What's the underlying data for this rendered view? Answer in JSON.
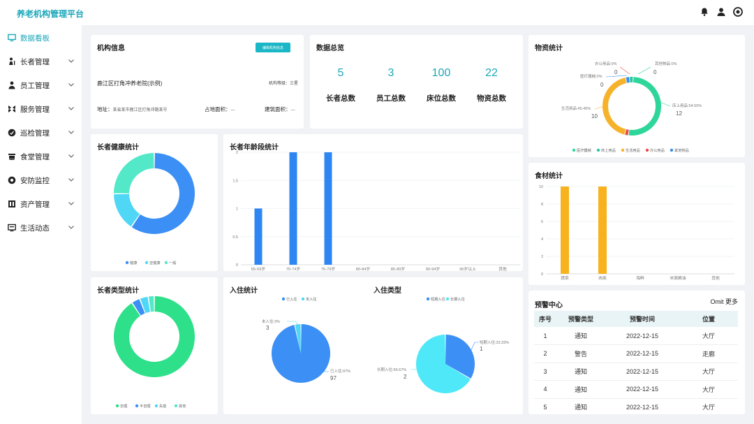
{
  "app": {
    "title": "养老机构管理平台"
  },
  "header_icons": [
    "bell-icon",
    "user-icon",
    "power-icon"
  ],
  "sidebar": {
    "items": [
      {
        "label": "数据看板",
        "icon": "monitor-icon",
        "active": true
      },
      {
        "label": "长者管理",
        "icon": "elder-icon"
      },
      {
        "label": "员工管理",
        "icon": "staff-icon"
      },
      {
        "label": "服务管理",
        "icon": "service-icon"
      },
      {
        "label": "巡检管理",
        "icon": "inspect-icon"
      },
      {
        "label": "食堂管理",
        "icon": "canteen-icon"
      },
      {
        "label": "安防监控",
        "icon": "camera-icon"
      },
      {
        "label": "资产管理",
        "icon": "asset-icon"
      },
      {
        "label": "生活动态",
        "icon": "life-icon"
      }
    ]
  },
  "org_info": {
    "title": "机构信息",
    "edit_label": "编辑机构信息",
    "name": "鹿江区打角冲养老院(示例)",
    "level_label": "机构等级：",
    "level_value": "三星",
    "address_label": "地址：",
    "address_value": "某省某市鹿江区打角冲路某号",
    "area_label": "占地面积：",
    "area_value": "—",
    "build_label": "建筑面积：",
    "build_value": "—"
  },
  "overview": {
    "title": "数据总览",
    "stats": [
      {
        "value": "5",
        "label": "长者总数"
      },
      {
        "value": "3",
        "label": "员工总数"
      },
      {
        "value": "100",
        "label": "床位总数"
      },
      {
        "value": "22",
        "label": "物资总数"
      }
    ]
  },
  "health": {
    "title": "长者健康统计",
    "legend": [
      "健康",
      "亚健康",
      "一般"
    ]
  },
  "age": {
    "title": "长者年龄段统计"
  },
  "elder_type": {
    "title": "长者类型统计",
    "legend": [
      "自理",
      "半自理",
      "失能",
      "其他"
    ]
  },
  "checkin": {
    "title": "入住统计",
    "legend": [
      "已入住",
      "未入住"
    ]
  },
  "checkin_type": {
    "title": "入住类型",
    "legend": [
      "短期入住",
      "长期入住"
    ]
  },
  "supplies": {
    "title": "物资统计",
    "legend": [
      "医疗器械",
      "床上用品",
      "生活用品",
      "办公用品",
      "其他物品"
    ]
  },
  "food": {
    "title": "食材统计"
  },
  "alerts": {
    "title": "预警中心",
    "more": "Omit 更多",
    "columns": [
      "序号",
      "预警类型",
      "预警时间",
      "位置"
    ],
    "rows": [
      {
        "no": "1",
        "type": "通知",
        "time": "2022-12-15",
        "loc": "大厅"
      },
      {
        "no": "2",
        "type": "警告",
        "time": "2022-12-15",
        "loc": "走廊"
      },
      {
        "no": "3",
        "type": "通知",
        "time": "2022-12-15",
        "loc": "大厅"
      },
      {
        "no": "4",
        "type": "通知",
        "time": "2022-12-15",
        "loc": "大厅"
      },
      {
        "no": "5",
        "type": "通知",
        "time": "2022-12-15",
        "loc": "大厅"
      }
    ]
  },
  "chart_data": [
    {
      "type": "pie",
      "title": "长者健康统计",
      "labels": [
        "健康",
        "亚健康",
        "一般"
      ],
      "values": [
        60,
        15,
        25
      ],
      "colors": [
        "#3b8ff5",
        "#4fd7f5",
        "#52e8c8"
      ]
    },
    {
      "type": "bar",
      "title": "长者年龄段统计",
      "categories": [
        "65-69岁",
        "70-74岁",
        "75-79岁",
        "80-84岁",
        "85-89岁",
        "90-94岁",
        "95岁以上",
        "其他"
      ],
      "values": [
        1,
        2,
        2,
        0,
        0,
        0,
        0,
        0
      ],
      "yticks": [
        "0",
        "0.5",
        "1",
        "1.5",
        "2"
      ],
      "ylim": [
        0,
        2
      ],
      "color": "#2e86f3"
    },
    {
      "type": "pie",
      "title": "长者类型统计",
      "labels": [
        "自理",
        "半自理",
        "失能",
        "其他"
      ],
      "values": [
        92,
        3,
        3,
        2
      ],
      "colors": [
        "#2ee08a",
        "#3b8ff5",
        "#4fd7f5",
        "#52e8c8"
      ]
    },
    {
      "type": "pie",
      "title": "入住统计",
      "labels": [
        "已入住",
        "未入住"
      ],
      "values": [
        97,
        3
      ],
      "data_labels": [
        "已入住:97%",
        "未入住:3%"
      ],
      "counts": [
        "97",
        "3"
      ],
      "colors": [
        "#3b8ff5",
        "#4fd7f5"
      ]
    },
    {
      "type": "pie",
      "title": "入住类型",
      "labels": [
        "短期入住",
        "长期入住"
      ],
      "values": [
        1,
        2
      ],
      "data_labels": [
        "短期入住:33.33%",
        "长期入住:66.67%"
      ],
      "counts": [
        "1",
        "2"
      ],
      "colors": [
        "#3b8ff5",
        "#4fe8f8"
      ]
    },
    {
      "type": "pie",
      "title": "物资统计",
      "labels": [
        "医疗器械",
        "床上用品",
        "生活用品",
        "办公用品",
        "其他物品"
      ],
      "values": [
        12,
        0,
        10,
        0,
        0
      ],
      "data_labels": [
        "床上用品:54.55%",
        "生活用品:45.45%",
        "医疗器械:0%",
        "办公用品:0%",
        "其他物品:0%"
      ],
      "counts": [
        "12",
        "10",
        "0",
        "0",
        "0"
      ],
      "colors": [
        "#2ed69a",
        "#27c9a0",
        "#f7b22b",
        "#ee4a4a",
        "#2f8ff0"
      ]
    },
    {
      "type": "bar",
      "title": "食材统计",
      "categories": [
        "蔬菜",
        "肉类",
        "海鲜",
        "米面粮油",
        "其他"
      ],
      "values": [
        10,
        10,
        0,
        0,
        0
      ],
      "yticks": [
        "0",
        "2",
        "4",
        "6",
        "8",
        "10"
      ],
      "ylim": [
        0,
        10
      ],
      "color": "#f7b21e"
    }
  ]
}
